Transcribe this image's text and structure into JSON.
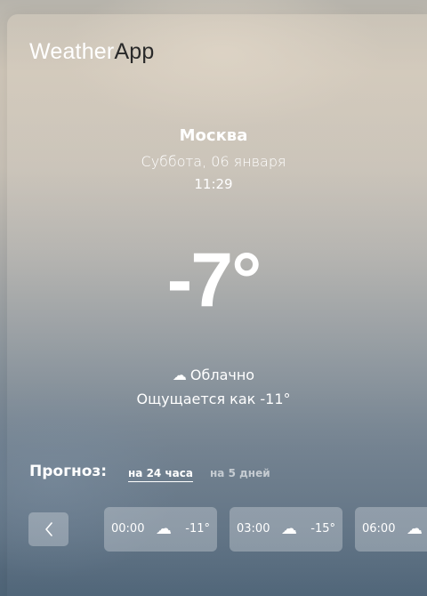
{
  "logo": {
    "part1": "Weather",
    "part2": "App"
  },
  "location": {
    "city": "Москва",
    "date": "Суббота, 06 января",
    "time": "11:29"
  },
  "current": {
    "temperature": "-7°",
    "condition_icon": "cloud-icon",
    "condition": "Облачно",
    "feels_like": "Ощущается как -11°"
  },
  "forecast": {
    "label": "Прогноз:",
    "tabs": [
      {
        "label": "на 24 часа",
        "active": true
      },
      {
        "label": "на 5 дней",
        "active": false
      }
    ],
    "hours": [
      {
        "time": "00:00",
        "icon": "cloud-icon",
        "temp": "-11°"
      },
      {
        "time": "03:00",
        "icon": "cloud-icon",
        "temp": "-15°"
      },
      {
        "time": "06:00",
        "icon": "cloud-icon",
        "temp": ""
      }
    ]
  },
  "colors": {
    "text": "#ffffff",
    "logo_dark": "#2a2a2a"
  }
}
